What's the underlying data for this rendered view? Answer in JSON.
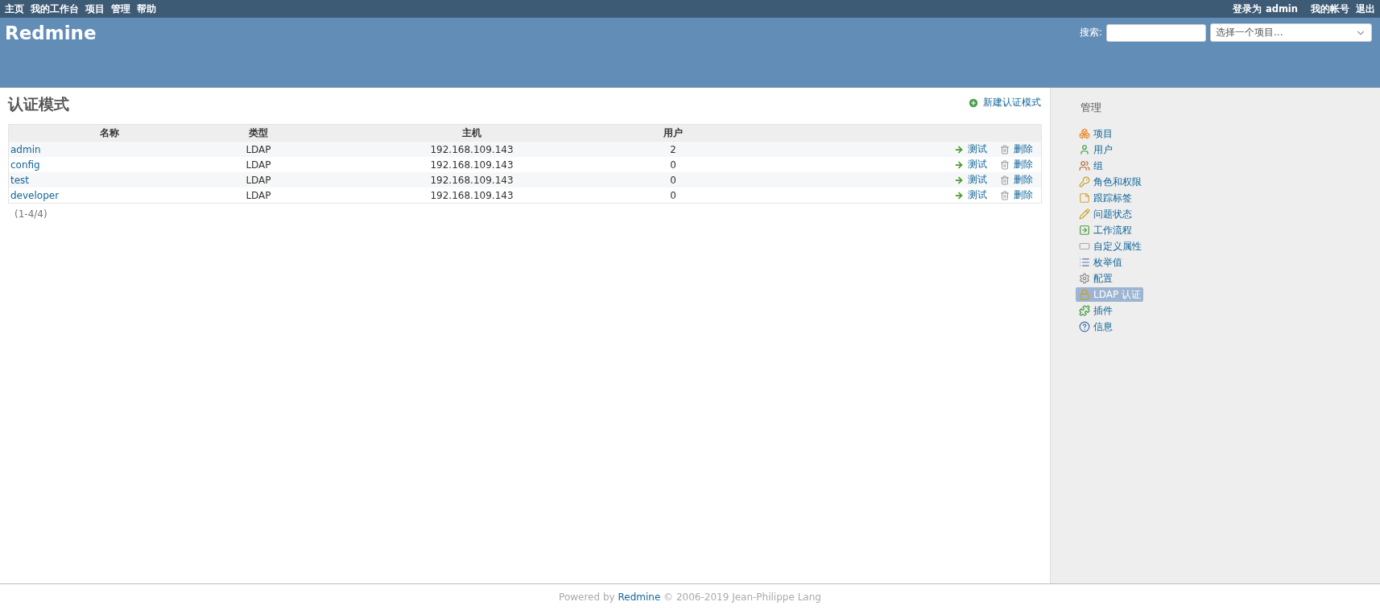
{
  "top_menu": {
    "left": [
      "主页",
      "我的工作台",
      "项目",
      "管理",
      "帮助"
    ],
    "logged_in_label": "登录为",
    "logged_in_user": "admin",
    "right": [
      "我的帐号",
      "退出"
    ]
  },
  "header": {
    "title": "Redmine",
    "search_label": "搜索:",
    "project_select": {
      "placeholder": "选择一个项目..."
    }
  },
  "content": {
    "title": "认证模式",
    "new_link": "新建认证模式",
    "table": {
      "columns": [
        "名称",
        "类型",
        "主机",
        "用户"
      ],
      "rows": [
        {
          "name": "admin",
          "type": "LDAP",
          "host": "192.168.109.143",
          "users": "2",
          "test": "测试",
          "delete": "删除"
        },
        {
          "name": "config",
          "type": "LDAP",
          "host": "192.168.109.143",
          "users": "0",
          "test": "测试",
          "delete": "删除"
        },
        {
          "name": "test",
          "type": "LDAP",
          "host": "192.168.109.143",
          "users": "0",
          "test": "测试",
          "delete": "删除"
        },
        {
          "name": "developer",
          "type": "LDAP",
          "host": "192.168.109.143",
          "users": "0",
          "test": "测试",
          "delete": "删除"
        }
      ]
    },
    "pagination": "(1-4/4)"
  },
  "sidebar": {
    "title": "管理",
    "items": [
      {
        "label": "项目",
        "selected": false
      },
      {
        "label": "用户",
        "selected": false
      },
      {
        "label": "组",
        "selected": false
      },
      {
        "label": "角色和权限",
        "selected": false
      },
      {
        "label": "跟踪标签",
        "selected": false
      },
      {
        "label": "问题状态",
        "selected": false
      },
      {
        "label": "工作流程",
        "selected": false
      },
      {
        "label": "自定义属性",
        "selected": false
      },
      {
        "label": "枚举值",
        "selected": false
      },
      {
        "label": "配置",
        "selected": false
      },
      {
        "label": "LDAP 认证",
        "selected": true
      },
      {
        "label": "插件",
        "selected": false
      },
      {
        "label": "信息",
        "selected": false
      }
    ]
  },
  "footer": {
    "prefix": "Powered by",
    "link": "Redmine",
    "suffix": "© 2006-2019 Jean-Philippe Lang"
  }
}
